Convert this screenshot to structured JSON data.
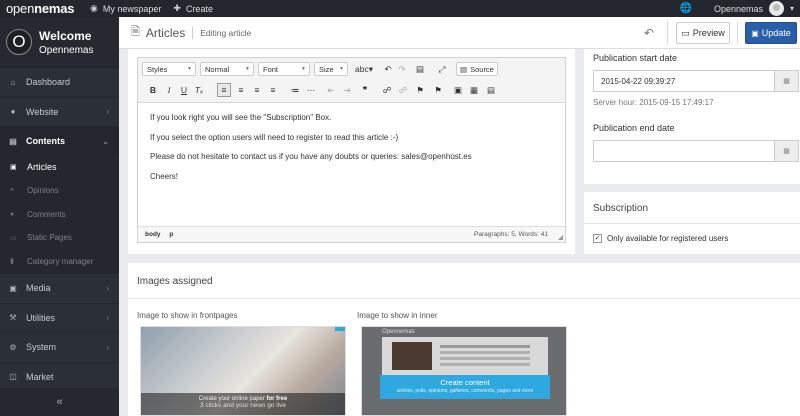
{
  "topbar": {
    "logo_light": "open",
    "logo_bold": "nemas",
    "my_newspaper": "My newspaper",
    "create": "Create",
    "user": "Opennemas"
  },
  "sidebar": {
    "welcome_title": "Welcome",
    "welcome_name": "Opennemas",
    "avatar_letter": "O",
    "items": {
      "dashboard": "Dashboard",
      "website": "Website",
      "contents": "Contents",
      "media": "Media",
      "utilities": "Utilities",
      "system": "System",
      "market": "Market"
    },
    "sub_items": {
      "articles": "Articles",
      "opinions": "Opinions",
      "comments": "Comments",
      "static_pages": "Static Pages",
      "category_manager": "Category manager"
    }
  },
  "header": {
    "title": "Articles",
    "subtitle": "Editing article",
    "preview": "Preview",
    "update": "Update"
  },
  "editor": {
    "styles": "Styles",
    "format": "Normal",
    "font": "Font",
    "size": "Size",
    "source": "Source",
    "paragraphs": [
      "If you look right you will see the \"Subscription\" Box.",
      "If you select the option users will need to register to read this article :-)",
      "Please do not hesitate to contact us if you have any doubts or queries: sales@openhost.es",
      "Cheers!"
    ],
    "path": [
      "body",
      "p"
    ],
    "word_count": "Paragraphs: 5, Words: 41"
  },
  "publication": {
    "start_label": "Publication start date",
    "start_value": "2015-04-22 09:39:27",
    "server_hour": "Server hour: 2015-09-15 17:49:17",
    "end_label": "Publication end date",
    "end_value": ""
  },
  "subscription": {
    "title": "Subscription",
    "checkbox_label": "Only available for registered users",
    "checked": true
  },
  "images": {
    "title": "Images assigned",
    "frontpage_label": "Image to show in frontpages",
    "inner_label": "Image to show in inner",
    "thumb1_line1_prefix": "Create your online paper",
    "thumb1_line1_bold": "for free",
    "thumb1_line2": "3 clicks and your news go live",
    "thumb2_top": "Opennemas",
    "thumb2_cta": "Create content",
    "thumb2_cta_small": "articles, polls, opinions, galleries, comments, pages and more"
  },
  "colors": {
    "topbar": "#23272d",
    "sidebar": "#2b3036",
    "primary": "#2a5ea8",
    "accent": "#2fa8e0"
  }
}
